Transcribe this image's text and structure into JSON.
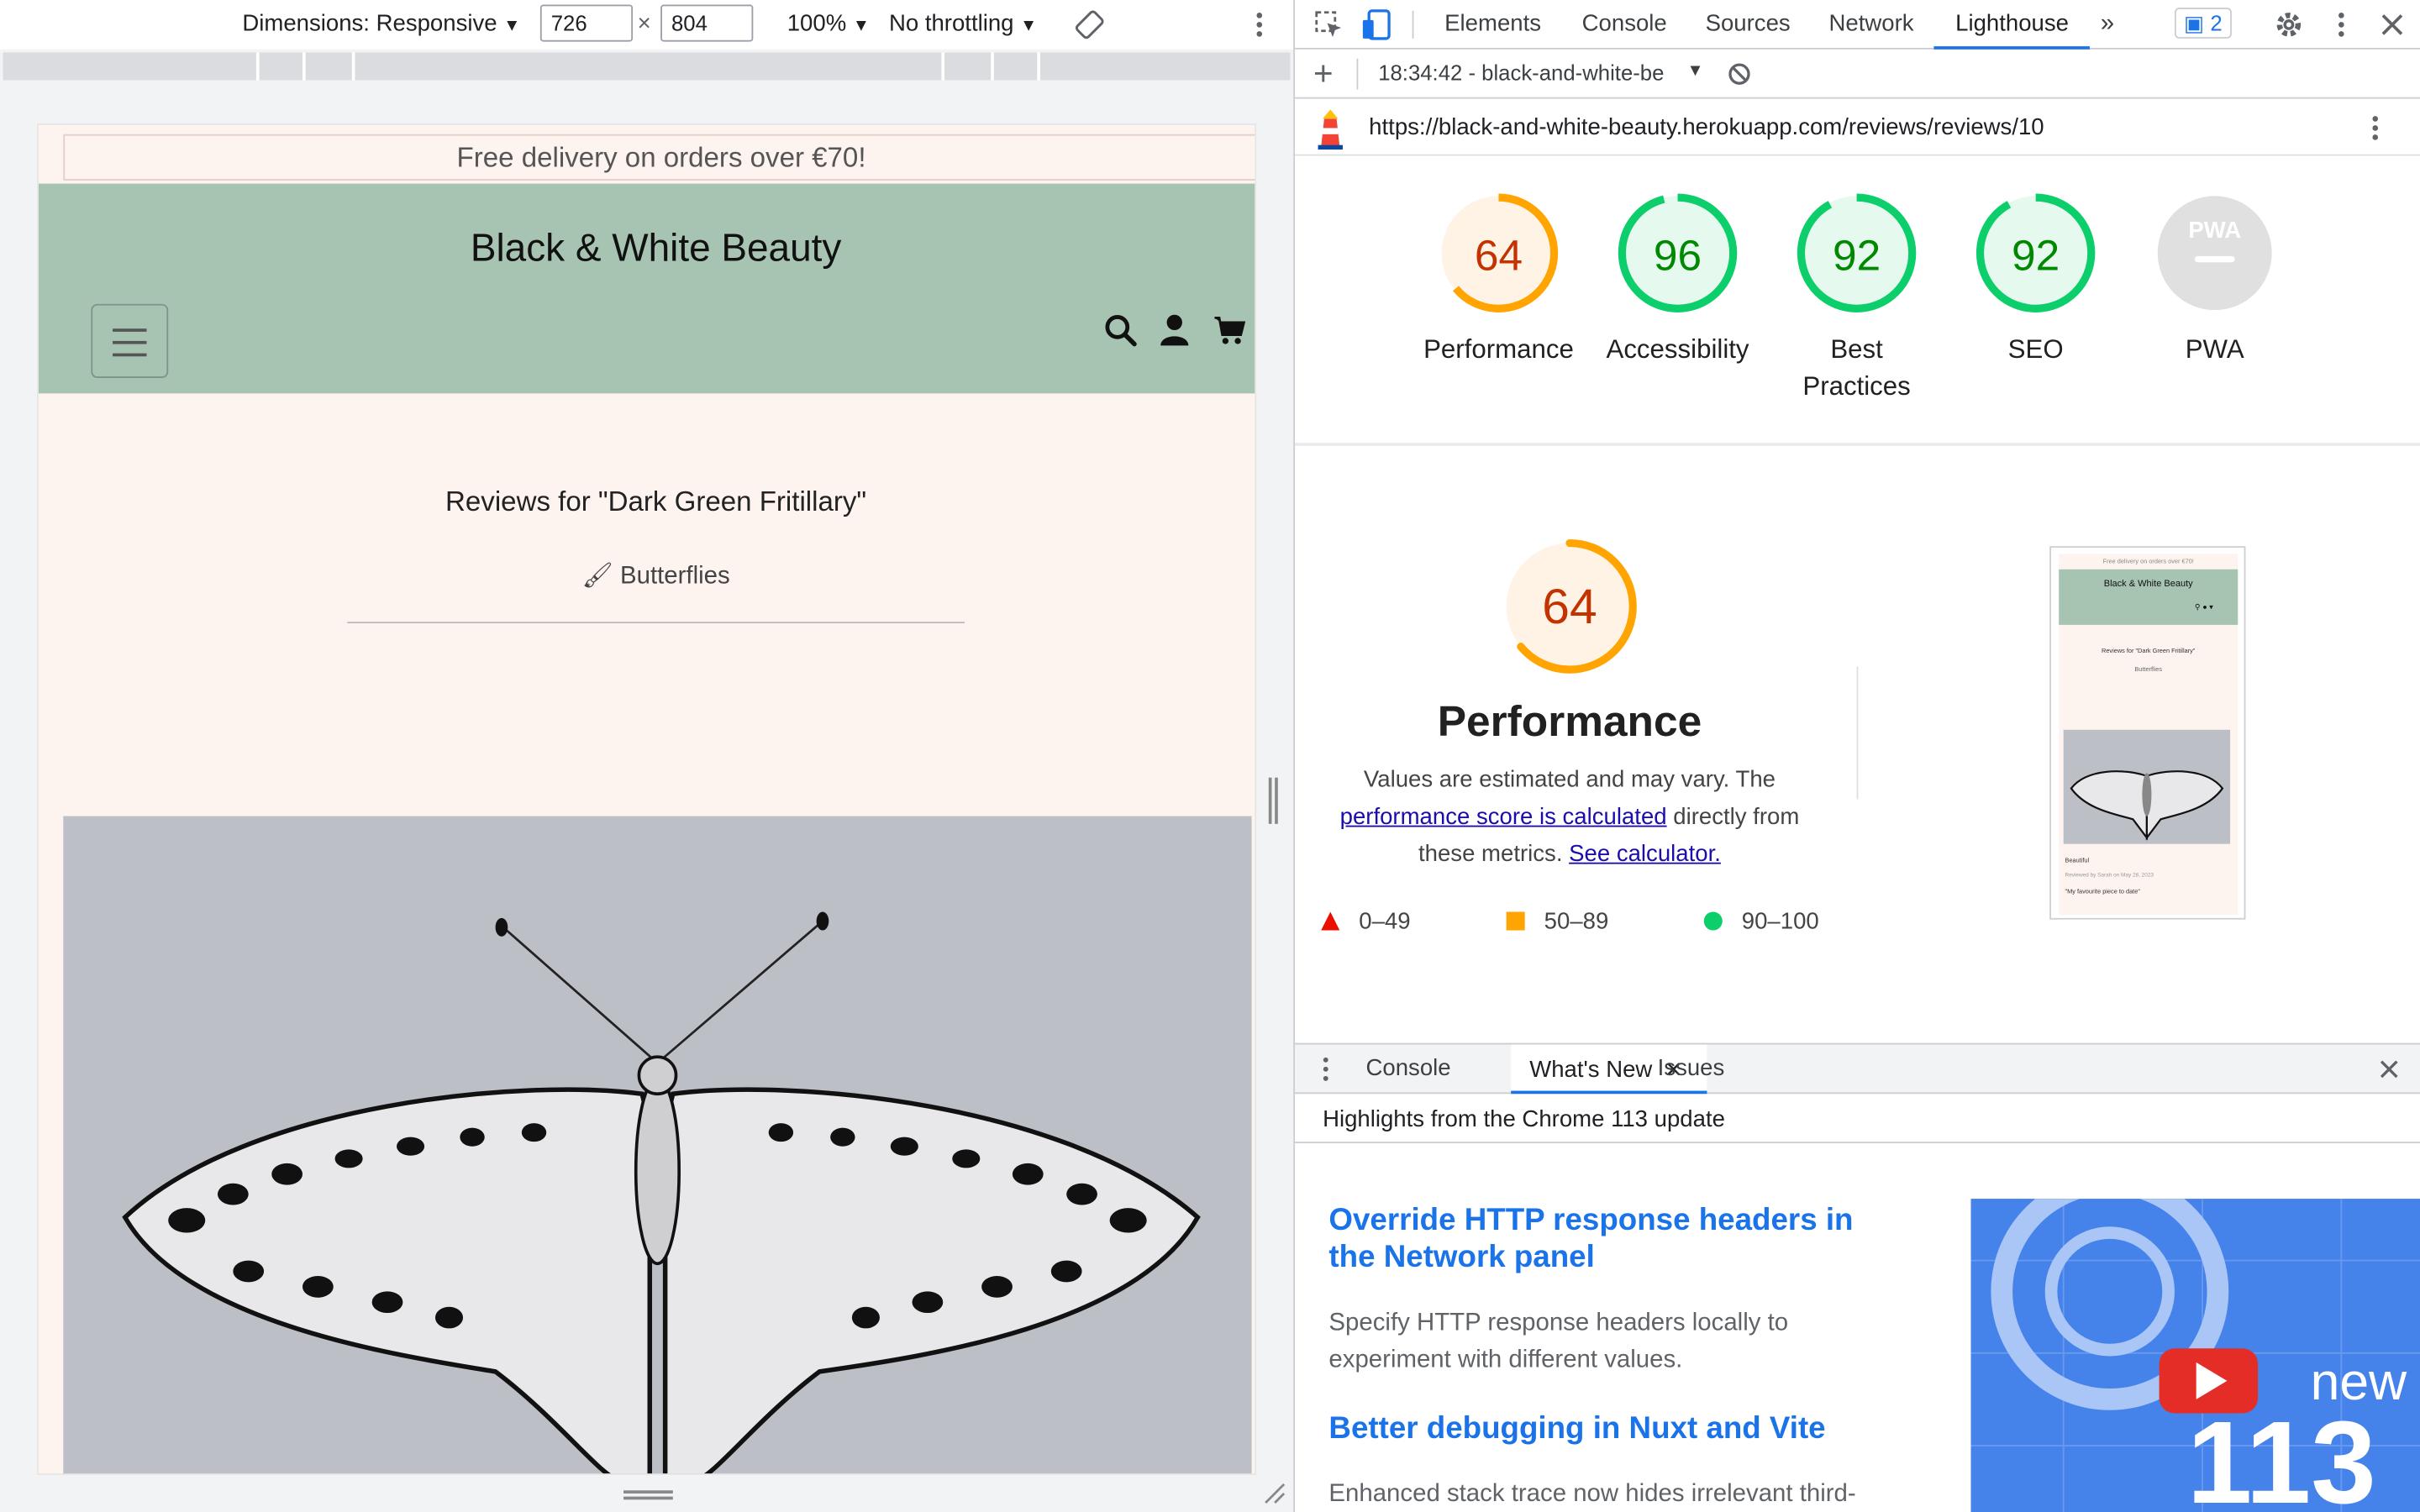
{
  "device_toolbar": {
    "dimensions": "Dimensions: Responsive",
    "width": "726",
    "times": "×",
    "height": "804",
    "zoom": "100%",
    "throttling": "No throttling"
  },
  "site": {
    "banner": "Free delivery on orders over €70!",
    "brand": "Black & White Beauty",
    "page_title": "Reviews for \"Dark Green Fritillary\"",
    "category": "Butterflies"
  },
  "devtools": {
    "tabs": [
      "Elements",
      "Console",
      "Sources",
      "Network",
      "Lighthouse"
    ],
    "active_tab": "Lighthouse",
    "issues_count": "2",
    "report_select": "18:34:42 - black-and-white-be",
    "url": "https://black-and-white-beauty.herokuapp.com/reviews/reviews/10"
  },
  "scores": [
    {
      "label": "Performance",
      "value": "64",
      "color": "#c33300",
      "ring": "#ffa400",
      "bg": "#fff3e6"
    },
    {
      "label": "Accessibility",
      "value": "96",
      "color": "#008800",
      "ring": "#0cce6b",
      "bg": "#e6f9ef"
    },
    {
      "label": "Best Practices",
      "value": "92",
      "color": "#008800",
      "ring": "#0cce6b",
      "bg": "#e6f9ef"
    },
    {
      "label": "SEO",
      "value": "92",
      "color": "#008800",
      "ring": "#0cce6b",
      "bg": "#e6f9ef"
    },
    {
      "label": "PWA",
      "value": "PWA",
      "color": "#9e9e9e",
      "ring": "#e0e0e0",
      "bg": "#e0e0e0"
    }
  ],
  "performance": {
    "score": "64",
    "title": "Performance",
    "desc_1": "Values are estimated and may vary. The",
    "link_1": "performance score is calculated",
    "desc_2": "directly from",
    "desc_3": "these metrics.",
    "link_2": "See calculator.",
    "legend": [
      "0–49",
      "50–89",
      "90–100"
    ]
  },
  "thumbnail": {
    "banner": "Free delivery on orders over €70!",
    "brand": "Black & White Beauty",
    "title": "Reviews for \"Dark Green Fritillary\"",
    "category": "Butterflies",
    "review_title": "Beautiful",
    "review_meta": "Reviewed by Sarah on May 28, 2023",
    "review_text": "\"My favourite piece to date\""
  },
  "drawer": {
    "tabs": [
      "Console",
      "What's New",
      "Issues"
    ],
    "active": "What's New",
    "header": "Highlights from the Chrome 113 update",
    "h1": "Override HTTP response headers in the Network panel",
    "p1": "Specify HTTP response headers locally to experiment with different values.",
    "h2": "Better debugging in Nuxt and Vite",
    "p2": "Enhanced stack trace now hides irrelevant third-",
    "promo_word": "new",
    "promo_num": "113"
  }
}
